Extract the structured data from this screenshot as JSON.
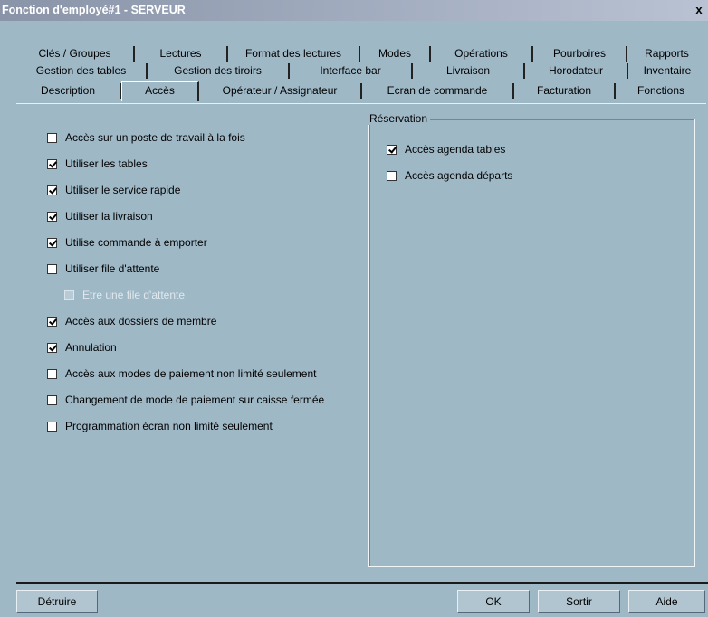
{
  "window": {
    "title": "Fonction d'employé#1 - SERVEUR",
    "close": "x"
  },
  "tabs": {
    "row1": [
      "Clés / Groupes",
      "Lectures",
      "Format des lectures",
      "Modes",
      "Opérations",
      "Pourboires",
      "Rapports"
    ],
    "row2": [
      "Gestion des tables",
      "Gestion des tiroirs",
      "Interface bar",
      "Livraison",
      "Horodateur",
      "Inventaire"
    ],
    "row3": [
      "Description",
      "Accès",
      "Opérateur / Assignateur",
      "Ecran de commande",
      "Facturation",
      "Fonctions"
    ],
    "active": "Accès"
  },
  "options": [
    {
      "label": "Accès sur un poste de travail à la fois",
      "checked": false,
      "disabled": false
    },
    {
      "label": "Utiliser les tables",
      "checked": true,
      "disabled": false
    },
    {
      "label": "Utiliser le service rapide",
      "checked": true,
      "disabled": false
    },
    {
      "label": "Utiliser la livraison",
      "checked": true,
      "disabled": false
    },
    {
      "label": "Utilise commande à emporter",
      "checked": true,
      "disabled": false
    },
    {
      "label": "Utiliser file d'attente",
      "checked": false,
      "disabled": false
    },
    {
      "label": "Etre une file d'attente",
      "checked": false,
      "disabled": true
    },
    {
      "label": "Accès aux dossiers de membre",
      "checked": true,
      "disabled": false
    },
    {
      "label": "Annulation",
      "checked": true,
      "disabled": false
    },
    {
      "label": "Accès aux modes de paiement non limité seulement",
      "checked": false,
      "disabled": false
    },
    {
      "label": "Changement de mode de paiement sur caisse fermée",
      "checked": false,
      "disabled": false
    },
    {
      "label": "Programmation écran non limité seulement",
      "checked": false,
      "disabled": false
    }
  ],
  "reservation": {
    "title": "Réservation",
    "options": [
      {
        "label": "Accès agenda tables",
        "checked": true
      },
      {
        "label": "Accès agenda départs",
        "checked": false
      }
    ]
  },
  "buttons": {
    "delete": "Détruire",
    "ok": "OK",
    "exit": "Sortir",
    "help": "Aide"
  }
}
